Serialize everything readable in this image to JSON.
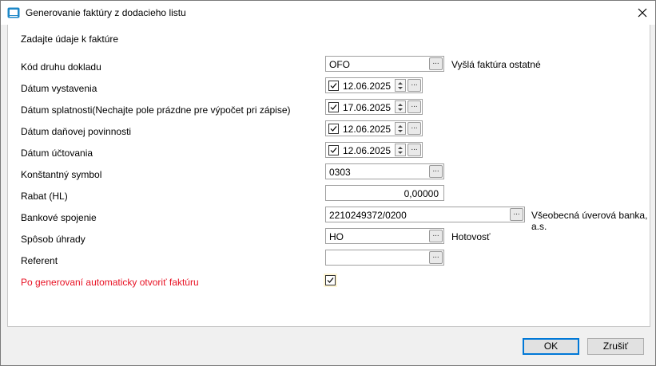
{
  "window": {
    "title": "Generovanie faktúry z dodacieho listu",
    "icon": "app-window-icon",
    "close_icon": "close-icon"
  },
  "intro": "Zadajte údaje k faktúre",
  "fields": {
    "kod_druhu": {
      "label": "Kód druhu dokladu",
      "value": "OFO",
      "desc": "Vyšlá faktúra ostatné"
    },
    "datum_vystavenia": {
      "label": "Dátum vystavenia",
      "value": "12.06.2025",
      "checked": true
    },
    "datum_splatnosti": {
      "label": "Dátum splatnosti(Nechajte pole prázdne pre výpočet pri zápise)",
      "value": "17.06.2025",
      "checked": true
    },
    "datum_danovej": {
      "label": "Dátum daňovej povinnosti",
      "value": "12.06.2025",
      "checked": true
    },
    "datum_uctovania": {
      "label": "Dátum účtovania",
      "value": "12.06.2025",
      "checked": true
    },
    "konstantny_symbol": {
      "label": "Konštantný symbol",
      "value": "0303"
    },
    "rabat": {
      "label": "Rabat (HL)",
      "value": "0,00000"
    },
    "bankove_spojenie": {
      "label": "Bankové spojenie",
      "value": "2210249372/0200",
      "desc": "Všeobecná úverová banka, a.s."
    },
    "sposob_uhrady": {
      "label": "Spôsob úhrady",
      "value": "HO",
      "desc": "Hotovosť"
    },
    "referent": {
      "label": "Referent",
      "value": ""
    },
    "auto_open": {
      "label": "Po generovaní automaticky otvoriť faktúru",
      "checked": true
    }
  },
  "browse_label": "...",
  "buttons": {
    "ok": "OK",
    "cancel": "Zrušiť"
  },
  "colors": {
    "accent": "#0078d7",
    "warning_label": "#e81123",
    "checkbox_highlight": "#fff6d5"
  }
}
